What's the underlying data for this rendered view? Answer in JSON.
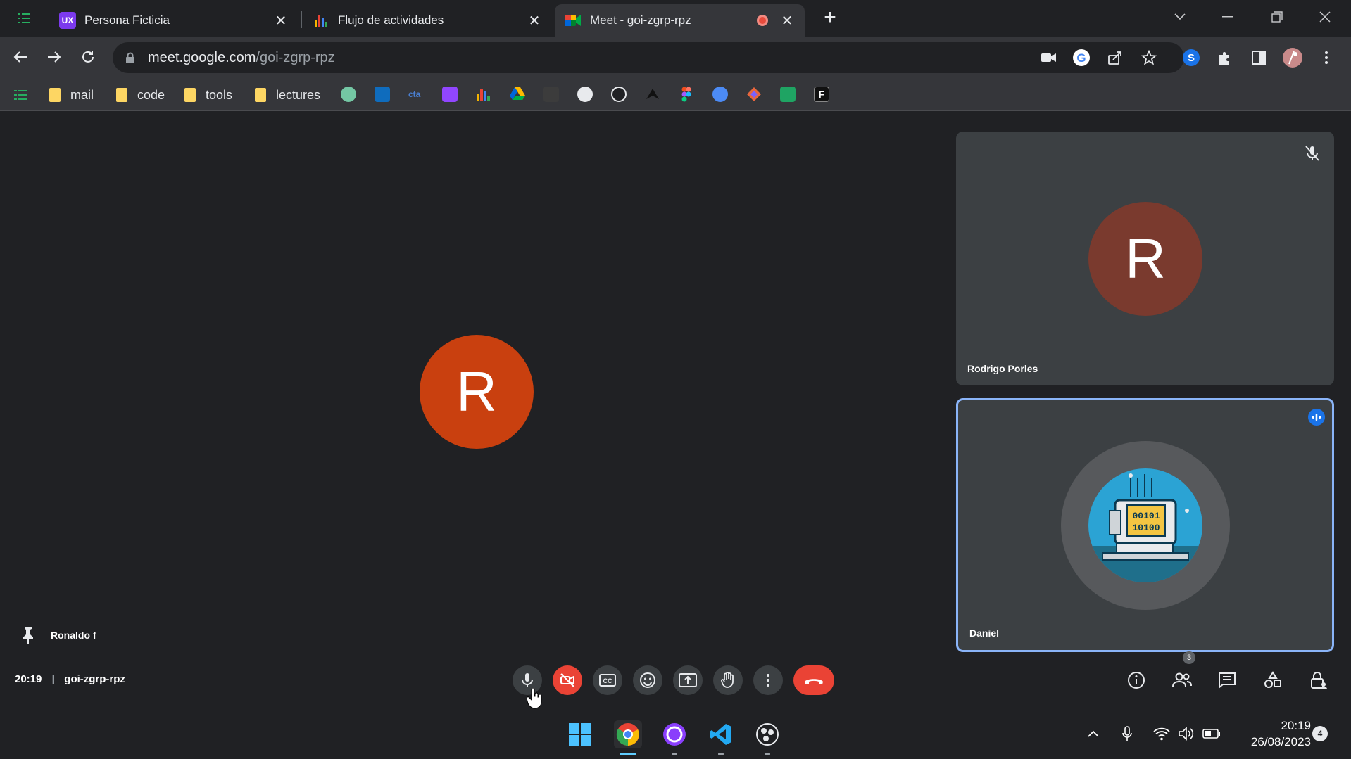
{
  "browser": {
    "tabs": [
      {
        "title": "Persona Ficticia",
        "favicon": "UX"
      },
      {
        "title": "Flujo de actividades",
        "favicon": "bar-chart-icon"
      },
      {
        "title": "Meet - goi-zgrp-rpz",
        "favicon": "meet-icon",
        "active": true,
        "recording": true
      }
    ],
    "url": {
      "host": "meet.google.com",
      "path": "/goi-zgrp-rpz"
    },
    "bookmarks": [
      "mail",
      "code",
      "tools",
      "lectures"
    ]
  },
  "meet": {
    "main_avatar_letter": "R",
    "main_avatar_color": "#c9400f",
    "pinned_participant": "Ronaldo f",
    "time": "20:19",
    "meeting_code": "goi-zgrp-rpz",
    "people_count": "3",
    "participants": [
      {
        "name": "Rodrigo Porles",
        "avatar_letter": "R",
        "muted": true
      },
      {
        "name": "Daniel",
        "speaking": true
      }
    ]
  },
  "taskbar": {
    "clock_time": "20:19",
    "clock_date": "26/08/2023",
    "notifications": "4"
  }
}
